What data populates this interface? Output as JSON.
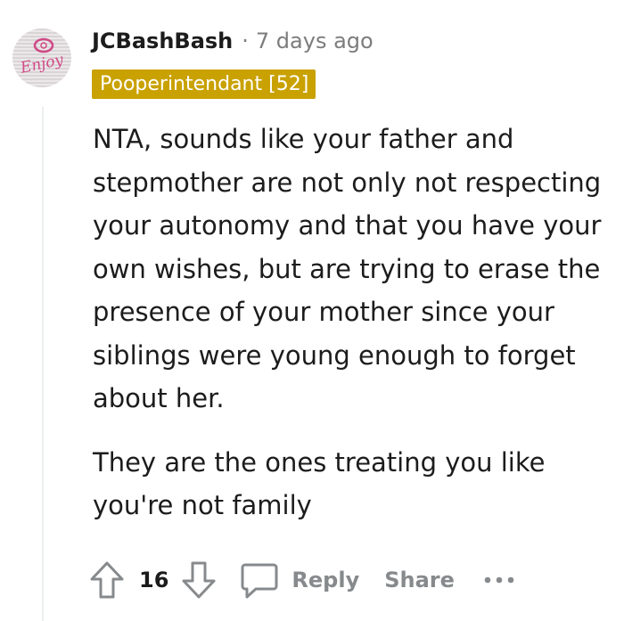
{
  "comment": {
    "username": "JCBashBash",
    "separator": "·",
    "timestamp": "7 days ago",
    "flair": "Pooperintendant [52]",
    "paragraphs": [
      "NTA, sounds like your father and stepmother are not only not respecting your autonomy and that you have your own wishes, but are trying to erase the presence of your mother since your siblings were young enough to forget about her.",
      "They are the ones treating you like you're not family"
    ]
  },
  "actions": {
    "score": "16",
    "reply_label": "Reply",
    "share_label": "Share",
    "more_glyph": "•••"
  },
  "avatar": {
    "logo_text": "Enjoy"
  },
  "icons": {
    "upvote": "upvote-arrow-icon",
    "downvote": "downvote-arrow-icon",
    "reply": "speech-bubble-icon",
    "more": "ellipsis-icon"
  },
  "colors": {
    "flair_bg": "#c9a100",
    "muted": "#7c7c7c",
    "action_gray": "#878a8c",
    "logo_pink": "#d04a86"
  }
}
